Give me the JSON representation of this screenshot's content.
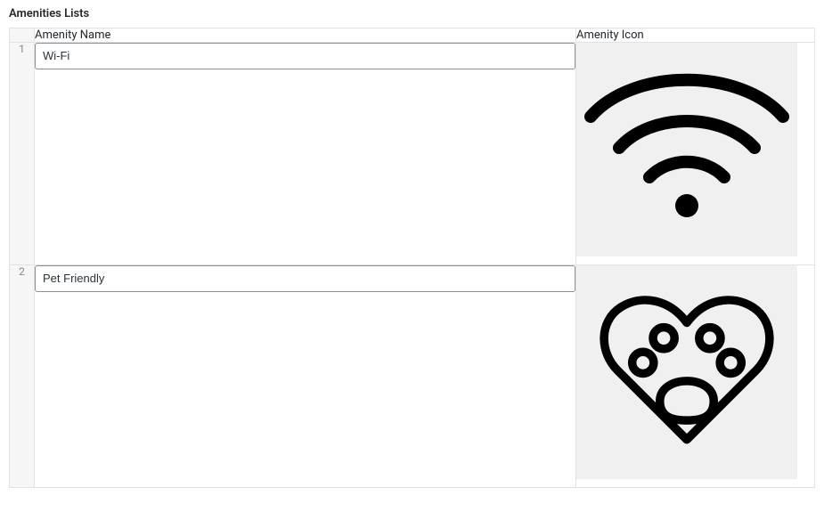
{
  "section": {
    "title": "Amenities Lists"
  },
  "columns": {
    "name": "Amenity Name",
    "icon": "Amenity Icon"
  },
  "rows": [
    {
      "index": "1",
      "name": "Wi-Fi",
      "icon": "wifi-icon"
    },
    {
      "index": "2",
      "name": "Pet Friendly",
      "icon": "paw-heart-icon"
    }
  ]
}
